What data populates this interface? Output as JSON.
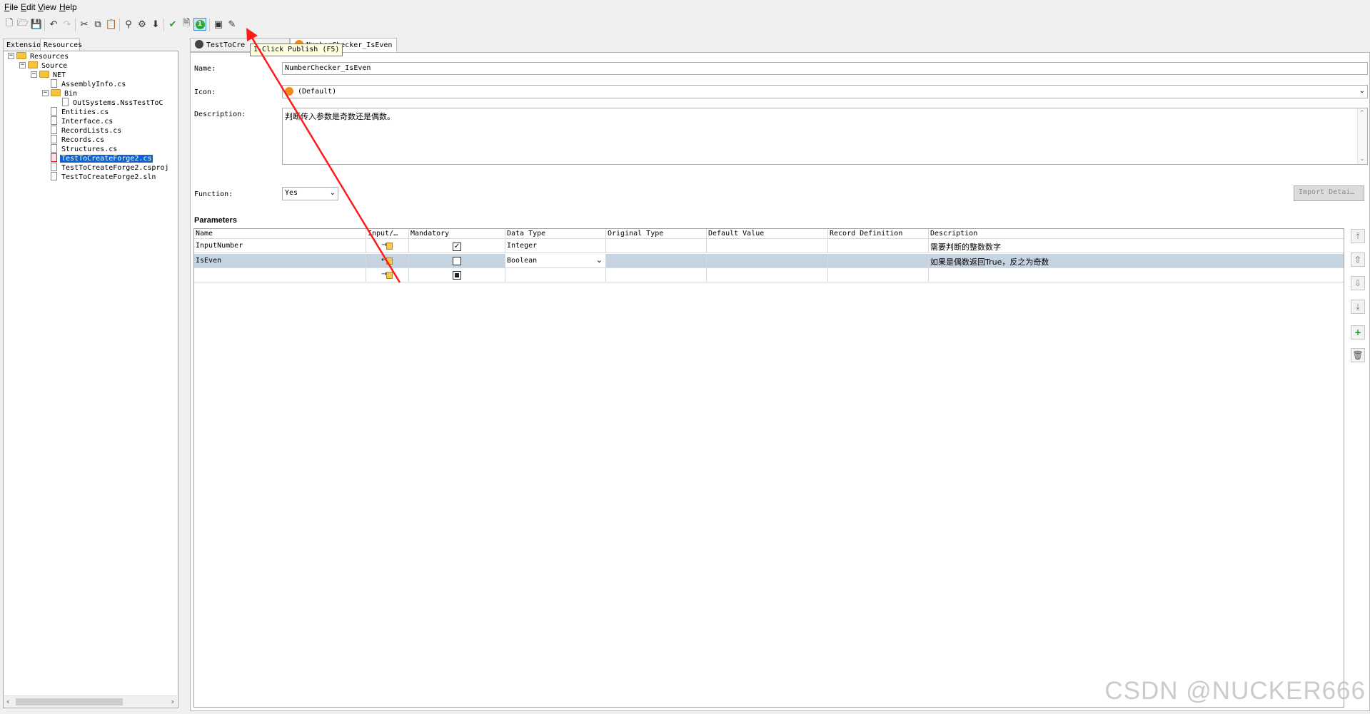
{
  "menu": [
    {
      "key": "F",
      "rest": "ile"
    },
    {
      "key": "E",
      "rest": "dit"
    },
    {
      "key": "V",
      "rest": "iew"
    },
    {
      "key": "H",
      "rest": "elp"
    }
  ],
  "toolbar": {
    "tooltip": "1-Click Publish (F5)",
    "publish_glyph": "1"
  },
  "left_tabs": [
    "Extension",
    "Resources"
  ],
  "tree": {
    "root": "Resources",
    "source": "Source",
    "net": "NET",
    "assemblyinfo": "AssemblyInfo.cs",
    "bin": "Bin",
    "dll": "OutSystems.NssTestToC",
    "entities": "Entities.cs",
    "interface": "Interface.cs",
    "recordlists": "RecordLists.cs",
    "records": "Records.cs",
    "structures": "Structures.cs",
    "main_cs": "TestToCreateForge2.cs",
    "csproj": "TestToCreateForge2.csproj",
    "sln": "TestToCreateForge2.sln"
  },
  "doc_tabs": {
    "first": "TestToCre",
    "second": "NumberChecker_IsEven"
  },
  "form": {
    "name_label": "Name:",
    "name_value": "NumberChecker_IsEven",
    "icon_label": "Icon:",
    "icon_value": "(Default)",
    "description_label": "Description:",
    "description_value": "判断传入参数是奇数还是偶数。",
    "function_label": "Function:",
    "function_value": "Yes",
    "import_button": "Import Detai…"
  },
  "parameters": {
    "title": "Parameters",
    "columns": [
      "Name",
      "Input/…",
      "Mandatory",
      "Data Type",
      "Original Type",
      "Default Value",
      "Record Definition",
      "Description"
    ],
    "rows": [
      {
        "name": "InputNumber",
        "direction": "input",
        "mandatory": "checked",
        "data_type": "Integer",
        "original_type": "",
        "default_value": "",
        "record_definition": "",
        "description": "需要判断的整数数字"
      },
      {
        "name": "IsEven",
        "direction": "output",
        "mandatory": "unchecked",
        "data_type": "Boolean",
        "original_type": "",
        "default_value": "",
        "record_definition": "",
        "description": "如果是偶数返回True，反之为奇数"
      },
      {
        "name": "",
        "direction": "input",
        "mandatory": "indeterminate",
        "data_type": "",
        "original_type": "",
        "default_value": "",
        "record_definition": "",
        "description": ""
      }
    ]
  },
  "watermark": "CSDN @NUCKER666",
  "colors": {
    "selection": "#0a64d4",
    "row_selected": "#c6d3e1",
    "annotation_arrow": "#ff1a1a",
    "tooltip_bg": "#ffffe1"
  }
}
